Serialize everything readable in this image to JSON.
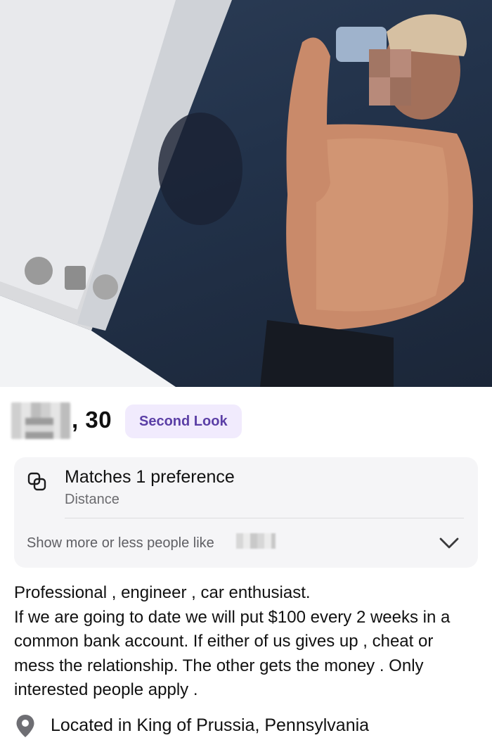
{
  "profile": {
    "age": ", 30",
    "badge": "Second Look"
  },
  "match": {
    "title": "Matches 1 preference",
    "subtitle": "Distance",
    "show_more": "Show more or less people like"
  },
  "bio": {
    "line1": "Professional , engineer , car enthusiast.",
    "line2": "If we are going to date we will put $100 every 2 weeks in a common bank account. If either of us gives up , cheat or mess the relationship. The other gets the money . Only interested people apply ."
  },
  "location": {
    "text": "Located in King of Prussia, Pennsylvania"
  },
  "icons": {
    "match": "overlapping-squares-icon",
    "expand": "chevron-down-icon",
    "location": "location-pin-icon"
  },
  "colors": {
    "badge_bg": "#f1ebfd",
    "badge_text": "#5b3fa6",
    "card_bg": "#f5f5f7"
  }
}
